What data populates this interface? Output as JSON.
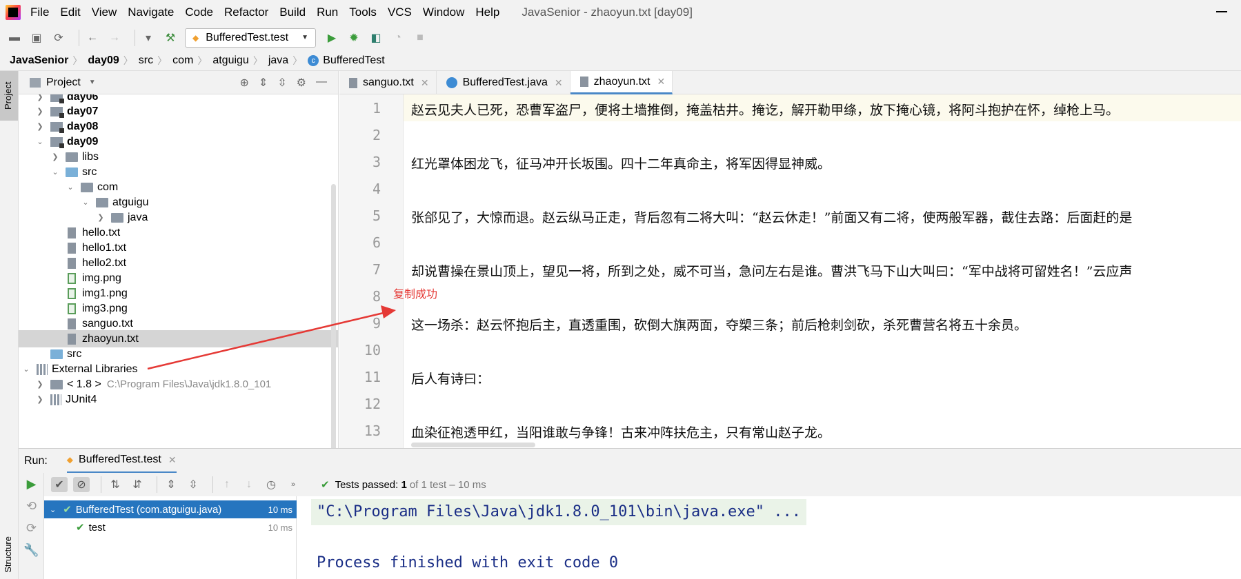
{
  "menubar": {
    "items": [
      "File",
      "Edit",
      "View",
      "Navigate",
      "Code",
      "Refactor",
      "Build",
      "Run",
      "Tools",
      "VCS",
      "Window",
      "Help"
    ],
    "title": "JavaSenior - zhaoyun.txt [day09]"
  },
  "toolbar": {
    "run_config": "BufferedTest.test"
  },
  "breadcrumb": [
    "JavaSenior",
    "day09",
    "src",
    "com",
    "atguigu",
    "java",
    "BufferedTest"
  ],
  "left_strip": {
    "project_tab": "Project",
    "structure_tab": "Structure"
  },
  "project": {
    "title": "Project",
    "tree": [
      {
        "label": "day06",
        "bold": true
      },
      {
        "label": "day07",
        "bold": true
      },
      {
        "label": "day08",
        "bold": true
      },
      {
        "label": "day09",
        "bold": true
      },
      {
        "label": "libs"
      },
      {
        "label": "src"
      },
      {
        "label": "com"
      },
      {
        "label": "atguigu"
      },
      {
        "label": "java"
      },
      {
        "label": "hello.txt"
      },
      {
        "label": "hello1.txt"
      },
      {
        "label": "hello2.txt"
      },
      {
        "label": "img.png"
      },
      {
        "label": "img1.png"
      },
      {
        "label": "img3.png"
      },
      {
        "label": "sanguo.txt"
      },
      {
        "label": "zhaoyun.txt"
      },
      {
        "label": "src"
      },
      {
        "label": "External Libraries"
      },
      {
        "label": "< 1.8 >",
        "path": "C:\\Program Files\\Java\\jdk1.8.0_101"
      },
      {
        "label": "JUnit4"
      }
    ]
  },
  "editor": {
    "tabs": [
      "sanguo.txt",
      "BufferedTest.java",
      "zhaoyun.txt"
    ],
    "active_tab": "zhaoyun.txt",
    "lines": [
      "赵云见夫人已死，恐曹军盗尸，便将土墙推倒，掩盖枯井。掩讫，解开勒甲绦，放下掩心镜，将阿斗抱护在怀，绰枪上马。",
      "",
      "红光罩体困龙飞，征马冲开长坂围。四十二年真命主，将军因得显神威。",
      "",
      "张郃见了，大惊而退。赵云纵马正走，背后忽有二将大叫：“赵云休走！”前面又有二将，使两般军器，截住去路：后面赶的是",
      "",
      "却说曹操在景山顶上，望见一将，所到之处，威不可当，急问左右是谁。曹洪飞马下山大叫曰：“军中战将可留姓名！”云应声",
      "",
      "这一场杀：赵云怀抱后主，直透重围，砍倒大旗两面，夺槊三条；前后枪刺剑砍，杀死曹营名将五十余员。",
      "",
      "后人有诗曰：",
      "",
      "血染征袍透甲红，当阳谁敢与争锋！古来冲阵扶危主，只有常山赵子龙。"
    ],
    "line_numbers": [
      "1",
      "2",
      "3",
      "4",
      "5",
      "6",
      "7",
      "8",
      "9",
      "10",
      "11",
      "12",
      "13"
    ]
  },
  "annotation": "复制成功",
  "run": {
    "label": "Run:",
    "tab": "BufferedTest.test",
    "status_prefix": "Tests passed:",
    "status_count": "1",
    "status_rest": "of 1 test – 10 ms",
    "tests": [
      {
        "name": "BufferedTest (com.atguigu.java)",
        "duration": "10 ms"
      },
      {
        "name": "test",
        "duration": "10 ms"
      }
    ],
    "console_cmd": "\"C:\\Program Files\\Java\\jdk1.8.0_101\\bin\\java.exe\" ...",
    "console_exit": "Process finished with exit code 0"
  }
}
